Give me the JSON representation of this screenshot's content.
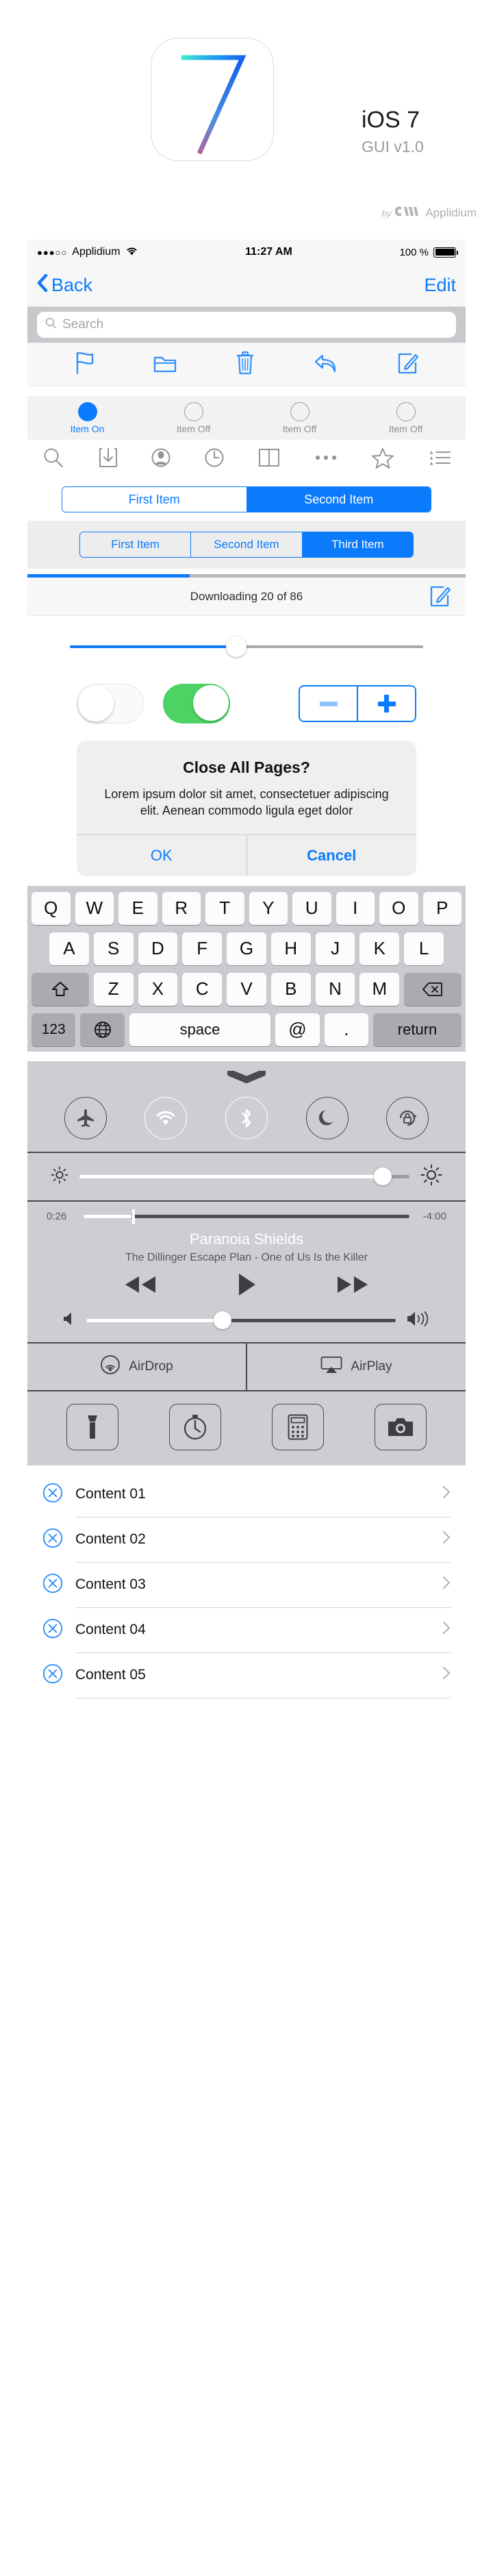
{
  "hero": {
    "icon_name": "ios7-app-icon",
    "title": "iOS 7",
    "subtitle": "GUI v1.0",
    "credit_by": "by",
    "credit_brand": "Applidium",
    "gradient": {
      "start": "#3ef0cd",
      "mid": "#1278f5",
      "end": "#f0486f"
    }
  },
  "statusbar": {
    "signal_dots": "●●●○○",
    "carrier": "Applidium",
    "wifi_icon": "wifi-icon",
    "time": "11:27 AM",
    "battery_percent": "100 %",
    "battery_level": 100
  },
  "navbar": {
    "back_label": "Back",
    "back_icon": "chevron-left-icon",
    "edit_label": "Edit",
    "tint": "#0b7bfb"
  },
  "search": {
    "placeholder": "Search",
    "value": "",
    "icon": "search-icon"
  },
  "toolbar_blue": {
    "items": [
      {
        "name": "flag-icon",
        "label": "Flag"
      },
      {
        "name": "folder-icon",
        "label": "Folder"
      },
      {
        "name": "trash-icon",
        "label": "Trash"
      },
      {
        "name": "reply-icon",
        "label": "Reply"
      },
      {
        "name": "compose-icon",
        "label": "Compose"
      }
    ]
  },
  "tabbar": {
    "items": [
      {
        "label": "Item On",
        "state": "on"
      },
      {
        "label": "Item Off",
        "state": "off"
      },
      {
        "label": "Item Off",
        "state": "off"
      },
      {
        "label": "Item Off",
        "state": "off"
      }
    ]
  },
  "toolbar_gray": {
    "items": [
      {
        "name": "search-icon"
      },
      {
        "name": "download-icon"
      },
      {
        "name": "contact-icon"
      },
      {
        "name": "clock-icon"
      },
      {
        "name": "book-icon"
      },
      {
        "name": "more-icon"
      },
      {
        "name": "star-icon"
      },
      {
        "name": "bookmark-list-icon"
      }
    ]
  },
  "segmented_two": {
    "options": [
      "First Item",
      "Second Item"
    ],
    "selected_index": 1
  },
  "segmented_three": {
    "options": [
      "First Item",
      "Second Item",
      "Third Item"
    ],
    "selected_index": 2
  },
  "download": {
    "progress_percent": 37,
    "status": "Downloading 20 of 86",
    "action_icon": "compose-icon"
  },
  "slider": {
    "value_percent": 47
  },
  "switches": {
    "off_label": "Off",
    "on_label": "On",
    "on_color": "#4cd364"
  },
  "stepper": {
    "minus_label": "−",
    "plus_label": "+",
    "minus_enabled": false
  },
  "alert": {
    "title": "Close All Pages?",
    "message": "Lorem ipsum dolor sit amet, consectetuer adipiscing elit. Aenean commodo ligula eget dolor",
    "ok_label": "OK",
    "cancel_label": "Cancel"
  },
  "keyboard": {
    "row1": [
      "Q",
      "W",
      "E",
      "R",
      "T",
      "Y",
      "U",
      "I",
      "O",
      "P"
    ],
    "row2": [
      "A",
      "S",
      "D",
      "F",
      "G",
      "H",
      "J",
      "K",
      "L"
    ],
    "row3": [
      "Z",
      "X",
      "C",
      "V",
      "B",
      "N",
      "M"
    ],
    "shift_icon": "shift-icon",
    "delete_icon": "delete-icon",
    "numbers_label": "123",
    "globe_icon": "globe-icon",
    "space_label": "space",
    "at_label": "@",
    "dot_label": ".",
    "return_label": "return"
  },
  "control_center": {
    "grabber": "grabber-handle",
    "toggles": [
      {
        "name": "airplane-mode-icon",
        "active": false
      },
      {
        "name": "wifi-icon",
        "active": true
      },
      {
        "name": "bluetooth-icon",
        "active": true
      },
      {
        "name": "do-not-disturb-icon",
        "active": false
      },
      {
        "name": "rotation-lock-icon",
        "active": false
      }
    ],
    "brightness": {
      "low_icon": "brightness-low-icon",
      "high_icon": "brightness-high-icon",
      "value_percent": 92
    },
    "player": {
      "elapsed": "0:26",
      "remaining": "-4:00",
      "progress_percent": 15,
      "track_title": "Paranoia Shields",
      "track_subtitle": "The Dillinger Escape Plan - One of Us Is the Killer",
      "prev_icon": "rewind-icon",
      "play_icon": "play-icon",
      "next_icon": "fast-forward-icon",
      "volume_percent": 44,
      "volume_low_icon": "volume-low-icon",
      "volume_high_icon": "volume-high-icon"
    },
    "airdrop_label": "AirDrop",
    "airdrop_icon": "airdrop-icon",
    "airplay_label": "AirPlay",
    "airplay_icon": "airplay-icon",
    "utilities": [
      {
        "name": "flashlight-icon"
      },
      {
        "name": "timer-icon"
      },
      {
        "name": "calculator-icon"
      },
      {
        "name": "camera-icon"
      }
    ]
  },
  "content_list": {
    "rows": [
      {
        "label": "Content 01",
        "left_icon": "delete-circle-icon",
        "chevron": "chevron-right-icon"
      },
      {
        "label": "Content 02",
        "left_icon": "delete-circle-icon",
        "chevron": "chevron-right-icon"
      },
      {
        "label": "Content 03",
        "left_icon": "delete-circle-icon",
        "chevron": "chevron-right-icon"
      },
      {
        "label": "Content 04",
        "left_icon": "delete-circle-icon",
        "chevron": "chevron-right-icon"
      },
      {
        "label": "Content 05",
        "left_icon": "delete-circle-icon",
        "chevron": "chevron-right-icon"
      }
    ]
  }
}
